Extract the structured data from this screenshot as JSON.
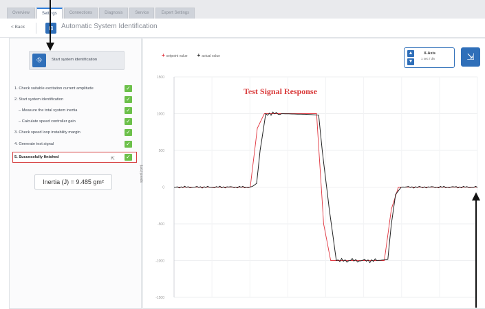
{
  "tabs": [
    {
      "label": "Overview"
    },
    {
      "label": "Settings"
    },
    {
      "label": "Connections"
    },
    {
      "label": "Diagnosis"
    },
    {
      "label": "Service"
    },
    {
      "label": "Expert Settings"
    }
  ],
  "header": {
    "back_label": "< Back",
    "title": "Automatic System Identification"
  },
  "left": {
    "start_button_label": "Start system identification",
    "steps": [
      {
        "label": "1. Check suitable excitation current amplitude"
      },
      {
        "label": "2. Start system identification"
      },
      {
        "label": "– Measure the total system inertia"
      },
      {
        "label": "– Calculate speed controller gain"
      },
      {
        "label": "3. Check speed loop instability margin"
      },
      {
        "label": "4. Generate test signal"
      },
      {
        "label": "5. Successfully finished"
      }
    ],
    "inertia_text": "Inertia (J) = 9.485 gm²"
  },
  "right": {
    "legend": [
      {
        "label": "setpoint value",
        "color": "#e0323c"
      },
      {
        "label": "actual value",
        "color": "#222222"
      }
    ],
    "xaxis_title": "X-Axis",
    "xaxis_subtitle": "1 sec / div"
  },
  "chart_data": {
    "type": "line",
    "title": "Test Signal Response",
    "ylabel": "speed [rpm]",
    "ylim": [
      -1500,
      1500
    ],
    "yticks": [
      1500,
      1000,
      500,
      0,
      -500,
      -1000,
      -1500
    ],
    "ytick_labels": [
      "1500",
      "1000",
      "500",
      "0",
      "-500",
      "-1000",
      "-1500"
    ],
    "grid": true,
    "series": [
      {
        "name": "setpoint value",
        "color": "#e0323c",
        "x": [
          0,
          1.08,
          1.18,
          1.28,
          1.5,
          1.9,
          2.02,
          2.12,
          2.22,
          2.5,
          2.9,
          2.98,
          3.08,
          3.18,
          3.5,
          4.3
        ],
        "y": [
          0,
          0,
          800,
          1000,
          1000,
          1000,
          1000,
          -500,
          -1000,
          -1000,
          -1000,
          -1000,
          -300,
          0,
          0,
          0
        ]
      },
      {
        "name": "actual value",
        "color": "#222222",
        "x": [
          0,
          1.1,
          1.17,
          1.22,
          1.3,
          1.5,
          1.9,
          2.05,
          2.1,
          2.2,
          2.3,
          2.5,
          2.9,
          3.03,
          3.08,
          3.14,
          3.22,
          3.5,
          4.3
        ],
        "y": [
          0,
          0,
          50,
          500,
          1000,
          1000,
          990,
          980,
          500,
          -300,
          -1000,
          -1000,
          -1000,
          -980,
          -500,
          -100,
          0,
          0,
          0
        ]
      }
    ]
  }
}
